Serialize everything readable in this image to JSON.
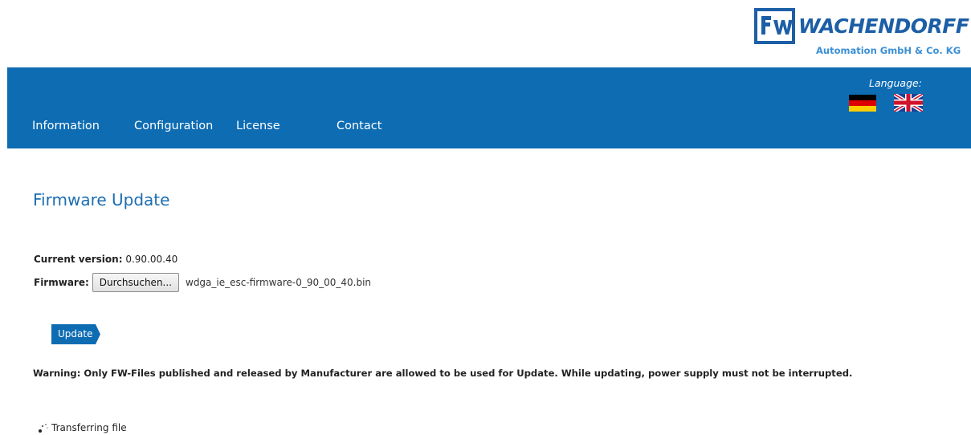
{
  "brand": {
    "name": "WACHENDORFF",
    "subtitle": "Automation GmbH & Co. KG",
    "mark_text": "Fw",
    "colors": {
      "primary": "#1c5fa6",
      "nav": "#0e6cb3",
      "accent": "#3b8fd4"
    }
  },
  "nav": {
    "items": [
      {
        "label": "Information"
      },
      {
        "label": "Configuration"
      },
      {
        "label": "License"
      },
      {
        "label": "Contact"
      }
    ],
    "language_label": "Language:",
    "languages": [
      {
        "code": "de",
        "icon": "german-flag-icon"
      },
      {
        "code": "en",
        "icon": "uk-flag-icon"
      }
    ]
  },
  "page": {
    "title": "Firmware Update",
    "current_version_label": "Current version:",
    "current_version_value": "0.90.00.40",
    "firmware_label": "Firmware:",
    "browse_label": "Durchsuchen...",
    "selected_file": "wdga_ie_esc-firmware-0_90_00_40.bin",
    "update_label": "Update",
    "warning": "Warning: Only FW-Files published and released by Manufacturer are allowed to be used for Update. While updating, power supply must not be interrupted.",
    "status_text": "Transferring file",
    "status_icon": "loading-spinner-icon"
  }
}
